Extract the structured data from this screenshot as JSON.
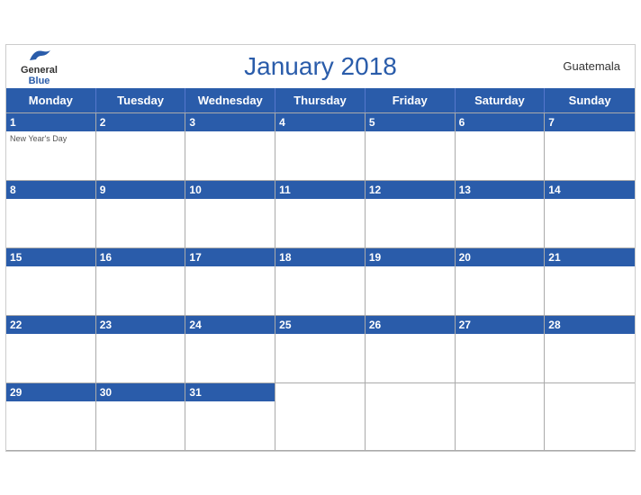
{
  "header": {
    "logo_general": "General",
    "logo_blue": "Blue",
    "title": "January 2018",
    "country": "Guatemala"
  },
  "weekdays": [
    "Monday",
    "Tuesday",
    "Wednesday",
    "Thursday",
    "Friday",
    "Saturday",
    "Sunday"
  ],
  "weeks": [
    [
      {
        "day": "1",
        "holiday": "New Year's Day"
      },
      {
        "day": "2",
        "holiday": ""
      },
      {
        "day": "3",
        "holiday": ""
      },
      {
        "day": "4",
        "holiday": ""
      },
      {
        "day": "5",
        "holiday": ""
      },
      {
        "day": "6",
        "holiday": ""
      },
      {
        "day": "7",
        "holiday": ""
      }
    ],
    [
      {
        "day": "8",
        "holiday": ""
      },
      {
        "day": "9",
        "holiday": ""
      },
      {
        "day": "10",
        "holiday": ""
      },
      {
        "day": "11",
        "holiday": ""
      },
      {
        "day": "12",
        "holiday": ""
      },
      {
        "day": "13",
        "holiday": ""
      },
      {
        "day": "14",
        "holiday": ""
      }
    ],
    [
      {
        "day": "15",
        "holiday": ""
      },
      {
        "day": "16",
        "holiday": ""
      },
      {
        "day": "17",
        "holiday": ""
      },
      {
        "day": "18",
        "holiday": ""
      },
      {
        "day": "19",
        "holiday": ""
      },
      {
        "day": "20",
        "holiday": ""
      },
      {
        "day": "21",
        "holiday": ""
      }
    ],
    [
      {
        "day": "22",
        "holiday": ""
      },
      {
        "day": "23",
        "holiday": ""
      },
      {
        "day": "24",
        "holiday": ""
      },
      {
        "day": "25",
        "holiday": ""
      },
      {
        "day": "26",
        "holiday": ""
      },
      {
        "day": "27",
        "holiday": ""
      },
      {
        "day": "28",
        "holiday": ""
      }
    ],
    [
      {
        "day": "29",
        "holiday": ""
      },
      {
        "day": "30",
        "holiday": ""
      },
      {
        "day": "31",
        "holiday": ""
      },
      {
        "day": "",
        "holiday": ""
      },
      {
        "day": "",
        "holiday": ""
      },
      {
        "day": "",
        "holiday": ""
      },
      {
        "day": "",
        "holiday": ""
      }
    ]
  ],
  "colors": {
    "header_blue": "#2a5caa",
    "weekday_bg": "#2a5caa",
    "day_number_bg": "#2a5caa"
  }
}
